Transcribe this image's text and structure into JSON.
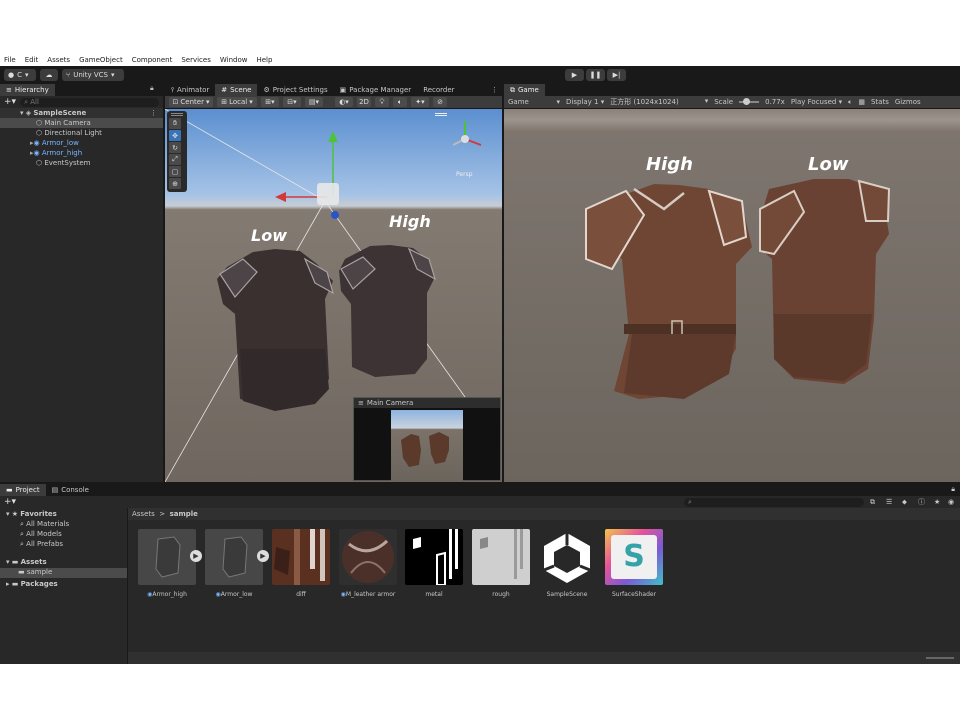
{
  "menu": [
    "File",
    "Edit",
    "Assets",
    "GameObject",
    "Component",
    "Services",
    "Window",
    "Help"
  ],
  "toolbar": {
    "account": "C",
    "vcs": "Unity VCS"
  },
  "hierarchy": {
    "tab": "Hierarchy",
    "search_placeholder": "All",
    "scene": "SampleScene",
    "items": [
      "Main Camera",
      "Directional Light",
      "Armor_low",
      "Armor_high",
      "EventSystem"
    ]
  },
  "scene_tabs": [
    "Animator",
    "Scene",
    "Project Settings",
    "Package Manager",
    "Recorder"
  ],
  "scene_toolbar": {
    "pivot": "Center",
    "space": "Local",
    "mode2d": "2D"
  },
  "scene_view": {
    "label_left": "Low",
    "label_right": "High",
    "persp": "Persp",
    "camera_preview": "Main Camera"
  },
  "game": {
    "tab": "Game",
    "mode": "Game",
    "display": "Display 1",
    "resolution": "正方形 (1024x1024)",
    "scale_label": "Scale",
    "scale_value": "0.77x",
    "play_mode": "Play Focused",
    "stats": "Stats",
    "gizmos": "Gizmos",
    "label_left": "High",
    "label_right": "Low"
  },
  "bottom_tabs": [
    "Project",
    "Console"
  ],
  "project": {
    "favorites": "Favorites",
    "fav_items": [
      "All Materials",
      "All Models",
      "All Prefabs"
    ],
    "assets": "Assets",
    "asset_children": [
      "sample"
    ],
    "packages": "Packages",
    "breadcrumb": [
      "Assets",
      "sample"
    ]
  },
  "assets_grid": [
    {
      "name": "Armor_high",
      "kind": "model"
    },
    {
      "name": "Armor_low",
      "kind": "model"
    },
    {
      "name": "diff",
      "kind": "texture"
    },
    {
      "name": "M_leather armor",
      "kind": "material"
    },
    {
      "name": "metal",
      "kind": "texture"
    },
    {
      "name": "rough",
      "kind": "texture"
    },
    {
      "name": "SampleScene",
      "kind": "scene"
    },
    {
      "name": "SurfaceShader",
      "kind": "shader"
    }
  ],
  "colors": {
    "editor_bg": "#191919",
    "panel_bg": "#282828",
    "selection": "#3a73b8",
    "sky": "#6f9fd6",
    "ground": "#6d665f",
    "leather": "#6b4330"
  }
}
